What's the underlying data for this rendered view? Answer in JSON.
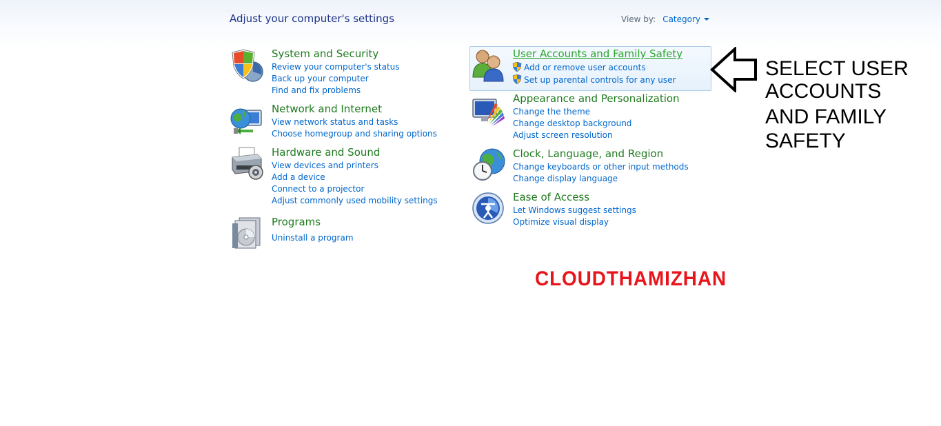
{
  "header": {
    "title": "Adjust your computer's settings",
    "view_by_label": "View by:",
    "view_by_value": "Category"
  },
  "categories": {
    "system_security": {
      "title": "System and Security",
      "links": [
        "Review your computer's status",
        "Back up your computer",
        "Find and fix problems"
      ],
      "icon": "shield-icon"
    },
    "network_internet": {
      "title": "Network and Internet",
      "links": [
        "View network status and tasks",
        "Choose homegroup and sharing options"
      ],
      "icon": "network-globe-icon"
    },
    "hardware_sound": {
      "title": "Hardware and Sound",
      "links": [
        "View devices and printers",
        "Add a device",
        "Connect to a projector",
        "Adjust commonly used mobility settings"
      ],
      "icon": "printer-icon"
    },
    "programs": {
      "title": "Programs",
      "links": [
        "Uninstall a program"
      ],
      "icon": "programs-disc-icon"
    },
    "user_accounts": {
      "title": "User Accounts and Family Safety",
      "links": [
        "Add or remove user accounts",
        "Set up parental controls for any user"
      ],
      "icon": "users-icon"
    },
    "appearance": {
      "title": "Appearance and Personalization",
      "links": [
        "Change the theme",
        "Change desktop background",
        "Adjust screen resolution"
      ],
      "icon": "monitor-palette-icon"
    },
    "clock_region": {
      "title": "Clock, Language, and Region",
      "links": [
        "Change keyboards or other input methods",
        "Change display language"
      ],
      "icon": "clock-globe-icon"
    },
    "ease_access": {
      "title": "Ease of Access",
      "links": [
        "Let Windows suggest settings",
        "Optimize visual display"
      ],
      "icon": "ease-of-access-icon"
    }
  },
  "annotation": {
    "lines": [
      "SELECT USER",
      "ACCOUNTS",
      "AND FAMILY",
      "SAFETY"
    ]
  },
  "watermark": "CLOUDTHAMIZHAN",
  "colors": {
    "title_blue": "#1e3287",
    "link_blue": "#0066cc",
    "category_green": "#1e7a1e",
    "watermark_red": "#e8141b"
  }
}
